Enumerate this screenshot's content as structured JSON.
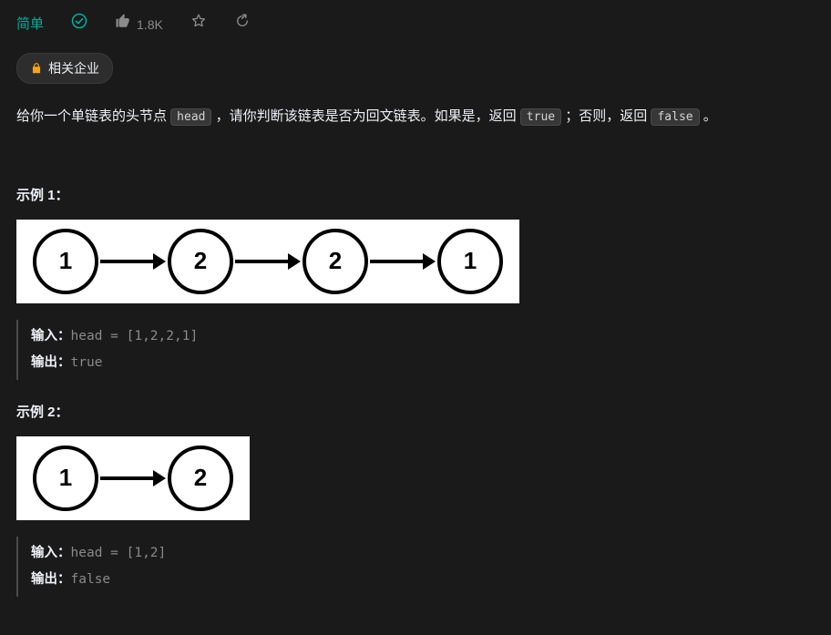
{
  "header": {
    "difficulty": "简单",
    "likes": "1.8K",
    "companies_label": "相关企业"
  },
  "description": {
    "part1": "给你一个单链表的头节点 ",
    "code1": "head",
    "part2": " ，请你判断该链表是否为回文链表。如果是，返回 ",
    "code2": "true",
    "part3": " ；否则，返回 ",
    "code3": "false",
    "part4": " 。"
  },
  "examples": [
    {
      "title": "示例 1：",
      "nodes": [
        "1",
        "2",
        "2",
        "1"
      ],
      "input_label": "输入：",
      "input_value": "head = [1,2,2,1]",
      "output_label": "输出：",
      "output_value": "true"
    },
    {
      "title": "示例 2：",
      "nodes": [
        "1",
        "2"
      ],
      "input_label": "输入：",
      "input_value": "head = [1,2]",
      "output_label": "输出：",
      "output_value": "false"
    }
  ]
}
